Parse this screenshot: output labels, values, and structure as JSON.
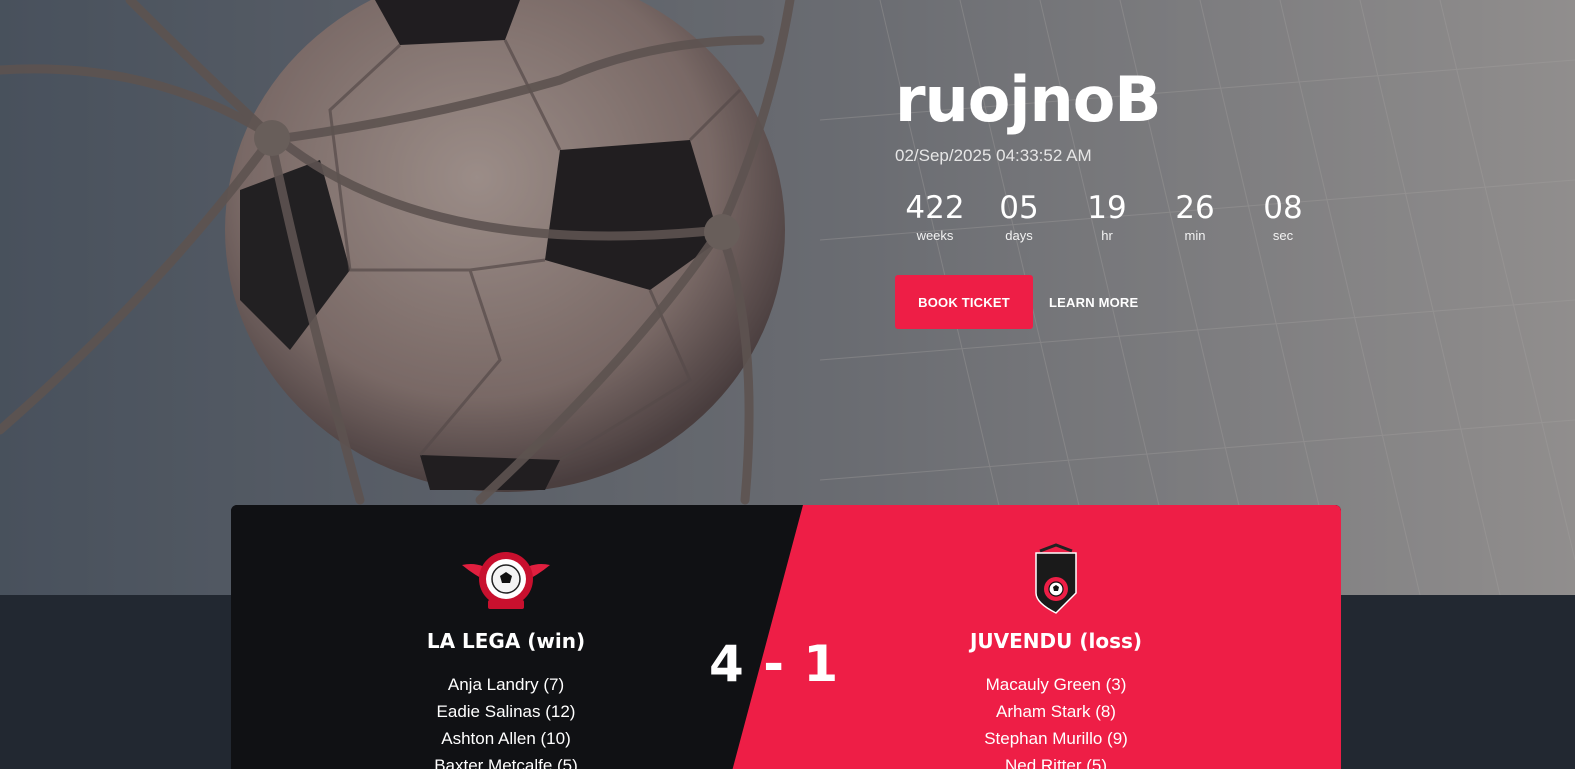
{
  "hero": {
    "title": "ruojnoB",
    "datetime": "02/Sep/2025 04:33:52 AM",
    "countdown": [
      {
        "value": "422",
        "label": "weeks"
      },
      {
        "value": "05",
        "label": "days"
      },
      {
        "value": "19",
        "label": "hr"
      },
      {
        "value": "26",
        "label": "min"
      },
      {
        "value": "08",
        "label": "sec"
      }
    ],
    "book_label": "BOOK TICKET",
    "learn_label": "LEARN MORE"
  },
  "match": {
    "score": "4 - 1",
    "home": {
      "name": "LA LEGA (win)",
      "players": [
        "Anja Landry (7)",
        "Eadie Salinas (12)",
        "Ashton Allen (10)",
        "Baxter Metcalfe (5)"
      ]
    },
    "away": {
      "name": "JUVENDU (loss)",
      "players": [
        "Macauly Green (3)",
        "Arham Stark (8)",
        "Stephan Murillo (9)",
        "Ned Ritter (5)"
      ]
    }
  },
  "colors": {
    "accent": "#ee1e46",
    "dark_panel": "#101114",
    "page_bg": "#222831"
  },
  "icons": {
    "home_logo": "football-league-badge",
    "away_logo": "soccer-shield-badge"
  }
}
